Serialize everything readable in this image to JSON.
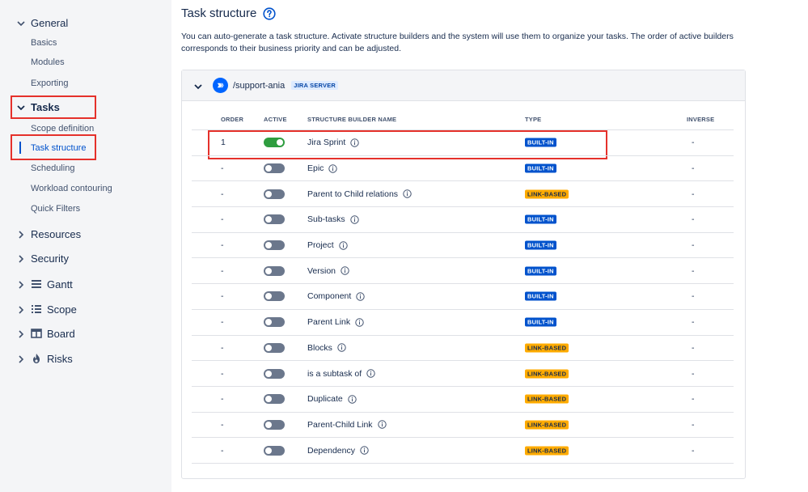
{
  "sidebar": {
    "general": {
      "label": "General",
      "items": [
        "Basics",
        "Modules",
        "Exporting"
      ]
    },
    "tasks": {
      "label": "Tasks",
      "items": [
        "Scope definition",
        "Task structure",
        "Scheduling",
        "Workload contouring",
        "Quick Filters"
      ],
      "active_item": "Task structure"
    },
    "groups": [
      {
        "label": "Resources",
        "icon": "none"
      },
      {
        "label": "Security",
        "icon": "none"
      },
      {
        "label": "Gantt",
        "icon": "gantt-icon"
      },
      {
        "label": "Scope",
        "icon": "list-icon"
      },
      {
        "label": "Board",
        "icon": "board-icon"
      },
      {
        "label": "Risks",
        "icon": "flame-icon"
      }
    ]
  },
  "main": {
    "title": "Task structure",
    "description": "You can auto-generate a task structure. Activate structure builders and the system will use them to organize your tasks. The order of active builders corresponds to their business priority and can be adjusted.",
    "project": {
      "name": "/support-ania",
      "server_badge": "JIRA SERVER"
    },
    "table": {
      "headers": {
        "order": "ORDER",
        "active": "ACTIVE",
        "name": "STRUCTURE BUILDER NAME",
        "type": "TYPE",
        "inverse": "INVERSE"
      },
      "rows": [
        {
          "order": "1",
          "active": true,
          "name": "Jira Sprint",
          "type": "BUILT-IN",
          "inverse": "-"
        },
        {
          "order": "-",
          "active": false,
          "name": "Epic",
          "type": "BUILT-IN",
          "inverse": "-"
        },
        {
          "order": "-",
          "active": false,
          "name": "Parent to Child relations",
          "type": "LINK-BASED",
          "inverse": "-"
        },
        {
          "order": "-",
          "active": false,
          "name": "Sub-tasks",
          "type": "BUILT-IN",
          "inverse": "-"
        },
        {
          "order": "-",
          "active": false,
          "name": "Project",
          "type": "BUILT-IN",
          "inverse": "-"
        },
        {
          "order": "-",
          "active": false,
          "name": "Version",
          "type": "BUILT-IN",
          "inverse": "-"
        },
        {
          "order": "-",
          "active": false,
          "name": "Component",
          "type": "BUILT-IN",
          "inverse": "-"
        },
        {
          "order": "-",
          "active": false,
          "name": "Parent Link",
          "type": "BUILT-IN",
          "inverse": "-"
        },
        {
          "order": "-",
          "active": false,
          "name": "Blocks",
          "type": "LINK-BASED",
          "inverse": "-"
        },
        {
          "order": "-",
          "active": false,
          "name": "is a subtask of",
          "type": "LINK-BASED",
          "inverse": "-"
        },
        {
          "order": "-",
          "active": false,
          "name": "Duplicate",
          "type": "LINK-BASED",
          "inverse": "-"
        },
        {
          "order": "-",
          "active": false,
          "name": "Parent-Child Link",
          "type": "LINK-BASED",
          "inverse": "-"
        },
        {
          "order": "-",
          "active": false,
          "name": "Dependency",
          "type": "LINK-BASED",
          "inverse": "-"
        }
      ]
    }
  },
  "colors": {
    "accent": "#0052cc",
    "highlight_box": "#e5312b",
    "toggle_on": "#2e9d3f",
    "toggle_off": "#6b778c",
    "builtin_badge": "#0052cc",
    "link_badge": "#ffab00"
  }
}
